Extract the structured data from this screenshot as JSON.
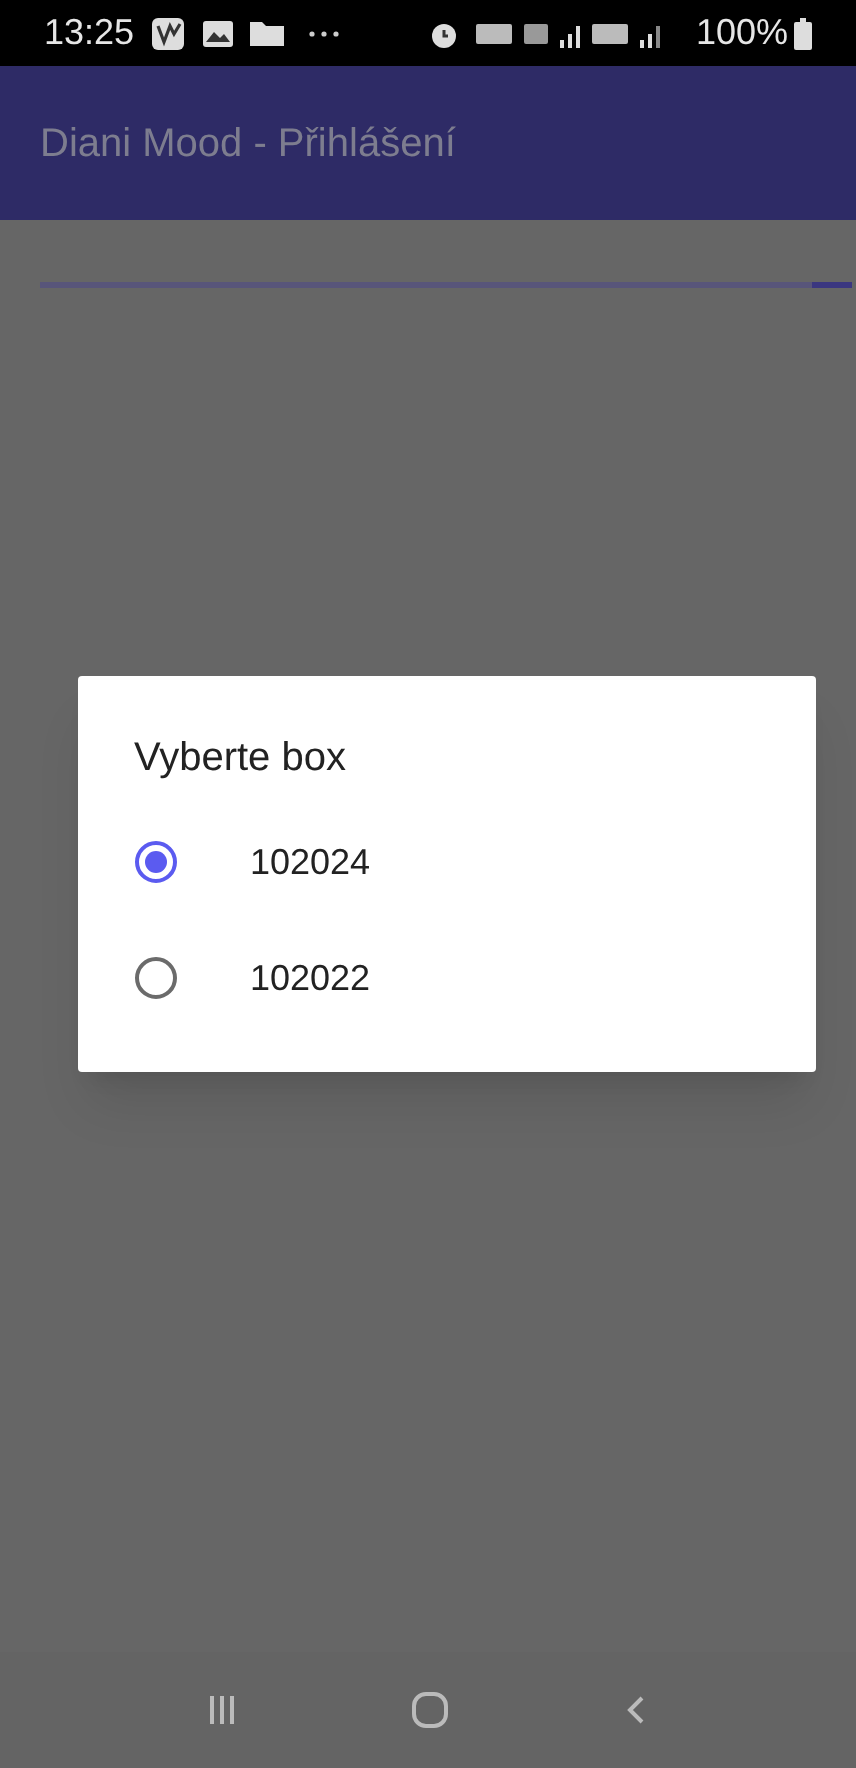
{
  "status_bar": {
    "time": "13:25",
    "battery": "100%"
  },
  "app_bar": {
    "title": "Diani Mood - Přihlášení"
  },
  "progress": {
    "level": 0.05
  },
  "dialog": {
    "title": "Vyberte box",
    "options": [
      {
        "label": "102024",
        "selected": true
      },
      {
        "label": "102022",
        "selected": false
      }
    ]
  }
}
